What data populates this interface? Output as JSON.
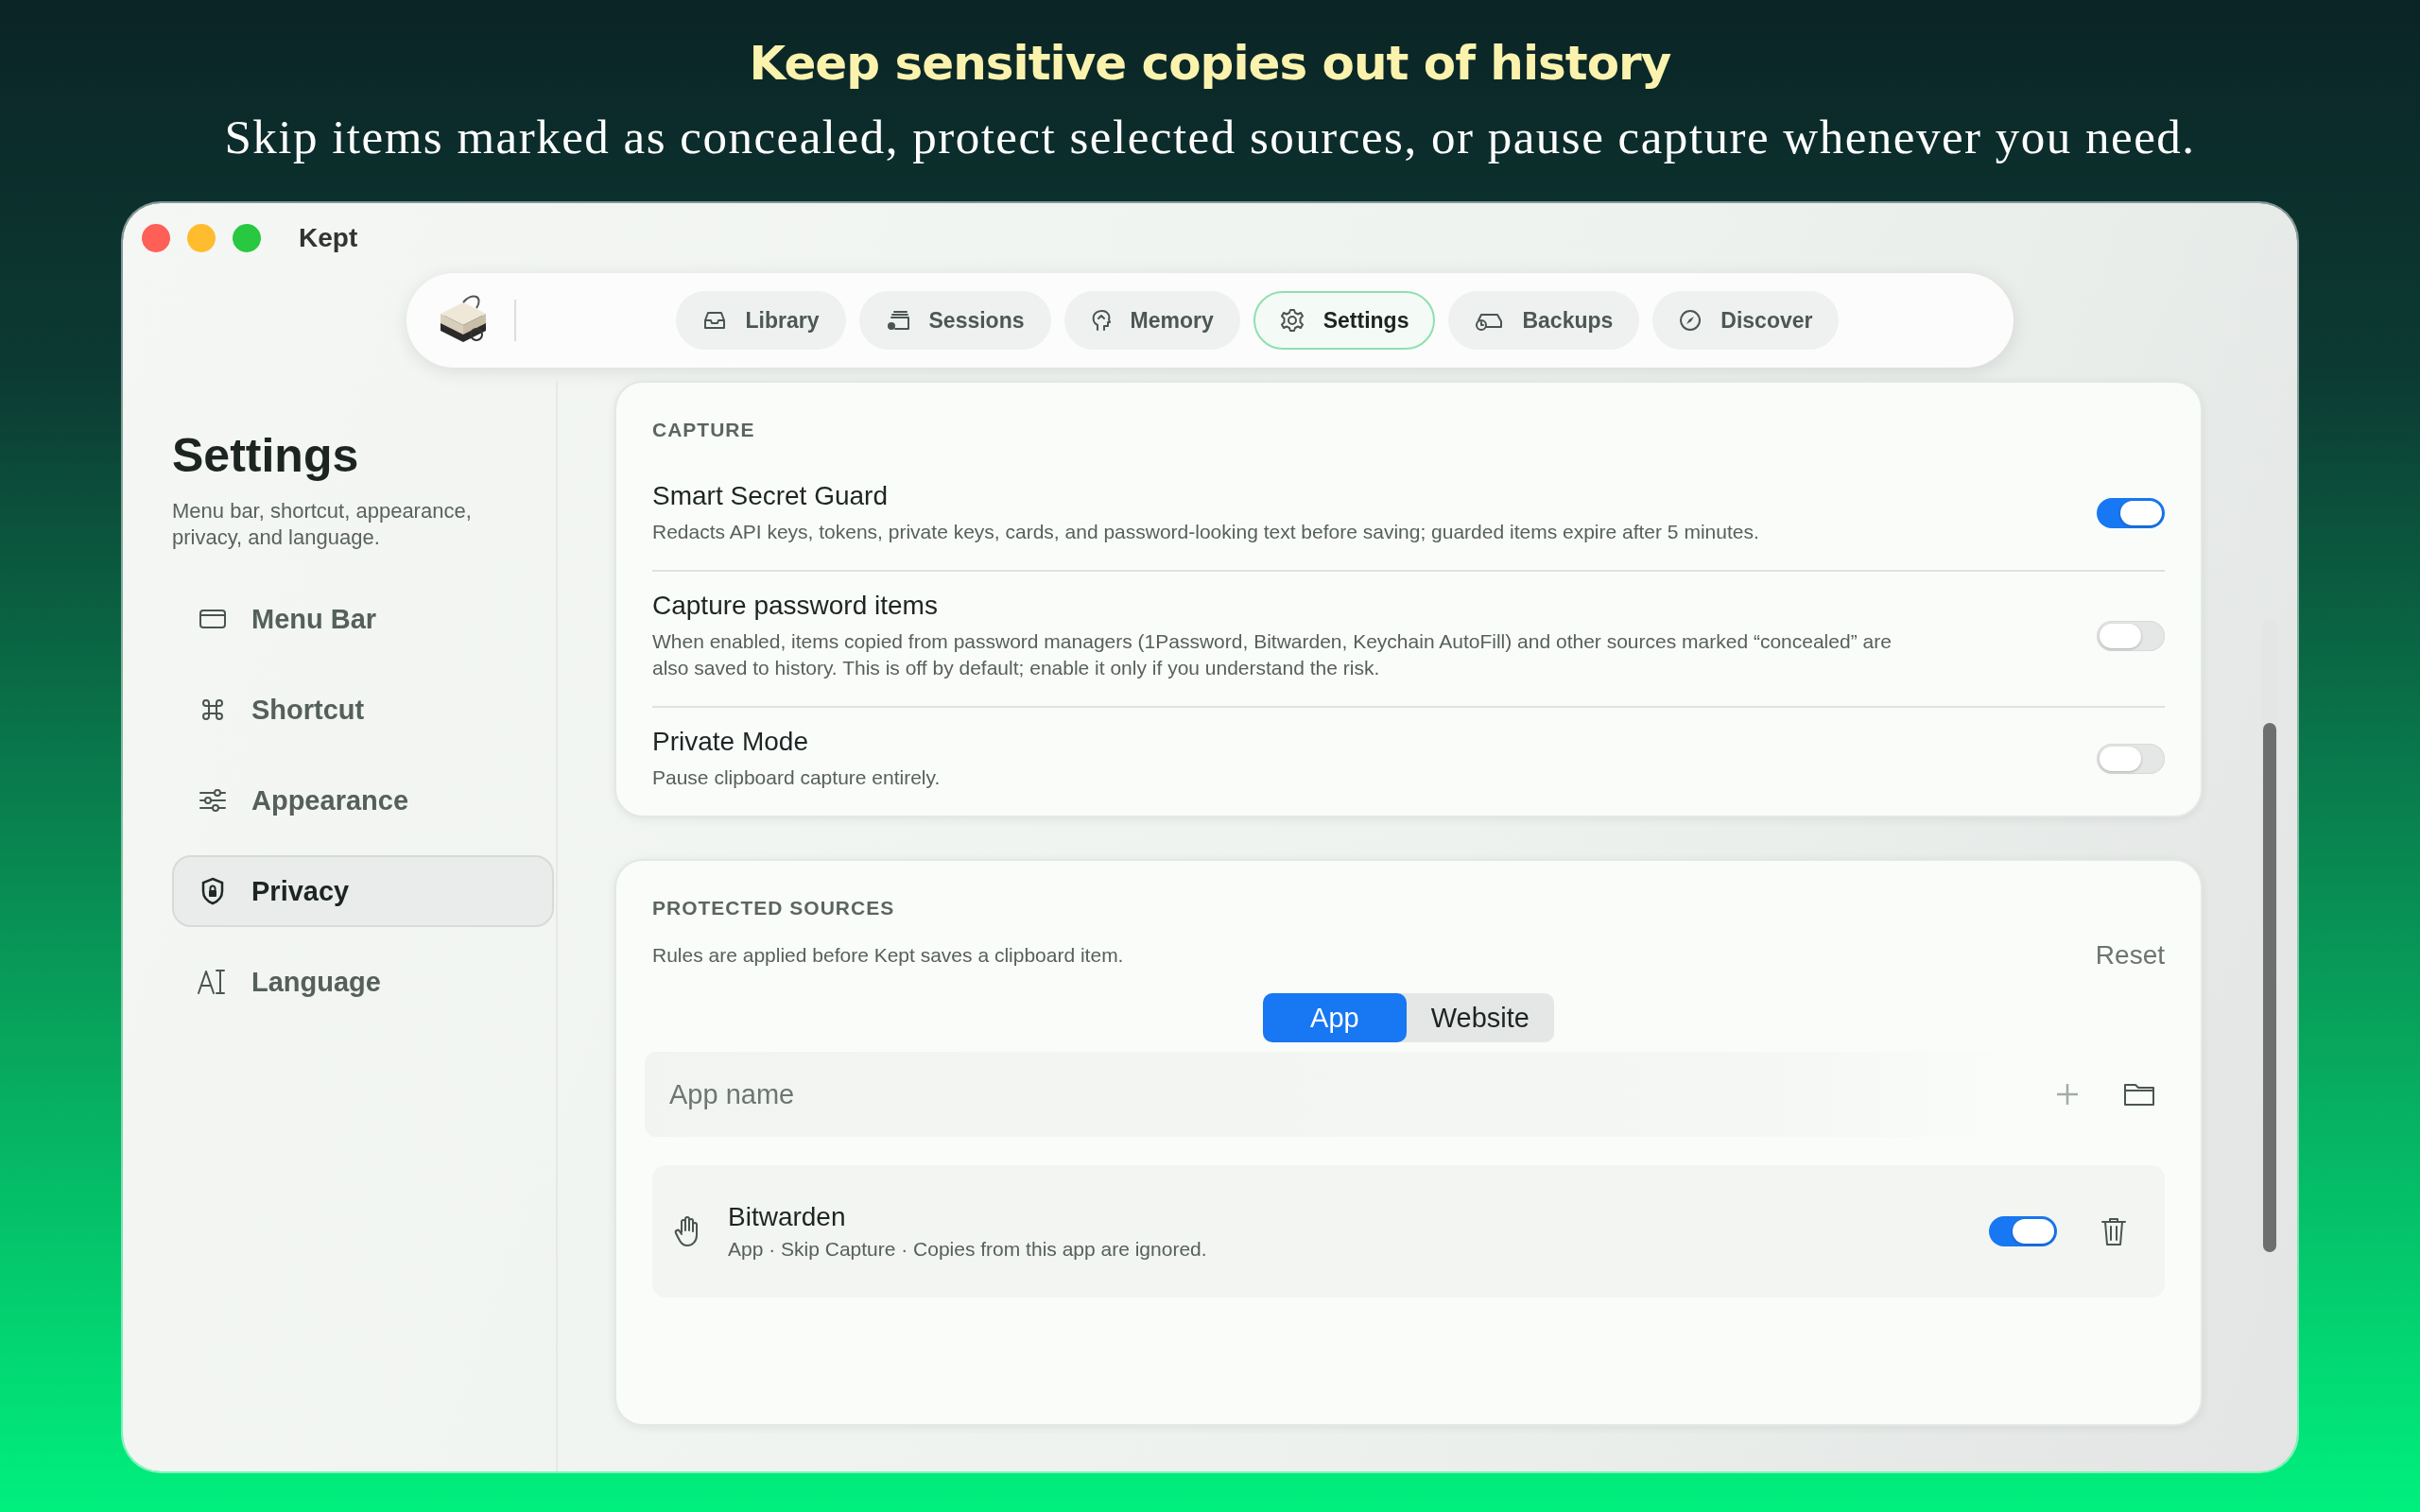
{
  "headline": {
    "title": "Keep sensitive copies out of history",
    "subtitle": "Skip items marked as concealed, protect selected sources, or pause capture whenever you need."
  },
  "window": {
    "title": "Kept"
  },
  "nav": {
    "tabs": [
      {
        "label": "Library",
        "selected": false
      },
      {
        "label": "Sessions",
        "selected": false
      },
      {
        "label": "Memory",
        "selected": false
      },
      {
        "label": "Settings",
        "selected": true
      },
      {
        "label": "Backups",
        "selected": false
      },
      {
        "label": "Discover",
        "selected": false
      }
    ]
  },
  "sidebar": {
    "title": "Settings",
    "subtitle": "Menu bar, shortcut, appearance, privacy, and language.",
    "items": [
      {
        "label": "Menu Bar",
        "selected": false
      },
      {
        "label": "Shortcut",
        "selected": false
      },
      {
        "label": "Appearance",
        "selected": false
      },
      {
        "label": "Privacy",
        "selected": true
      },
      {
        "label": "Language",
        "selected": false
      }
    ]
  },
  "capture": {
    "heading": "CAPTURE",
    "settings": [
      {
        "title": "Smart Secret Guard",
        "description": "Redacts API keys, tokens, private keys, cards, and password-looking text before saving; guarded items expire after 5 minutes.",
        "on": true
      },
      {
        "title": "Capture password items",
        "description": "When enabled, items copied from password managers (1Password, Bitwarden, Keychain AutoFill) and other sources marked “concealed” are also saved to history. This is off by default; enable it only if you understand the risk.",
        "on": false
      },
      {
        "title": "Private Mode",
        "description": "Pause clipboard capture entirely.",
        "on": false
      }
    ]
  },
  "protected_sources": {
    "heading": "PROTECTED SOURCES",
    "description": "Rules are applied before Kept saves a clipboard item.",
    "reset": "Reset",
    "segments": [
      {
        "label": "App",
        "selected": true
      },
      {
        "label": "Website",
        "selected": false
      }
    ],
    "input": {
      "placeholder": "App name"
    },
    "rules": [
      {
        "name": "Bitwarden",
        "detail": "App · Skip Capture · Copies from this app are ignored.",
        "on": true
      }
    ]
  }
}
